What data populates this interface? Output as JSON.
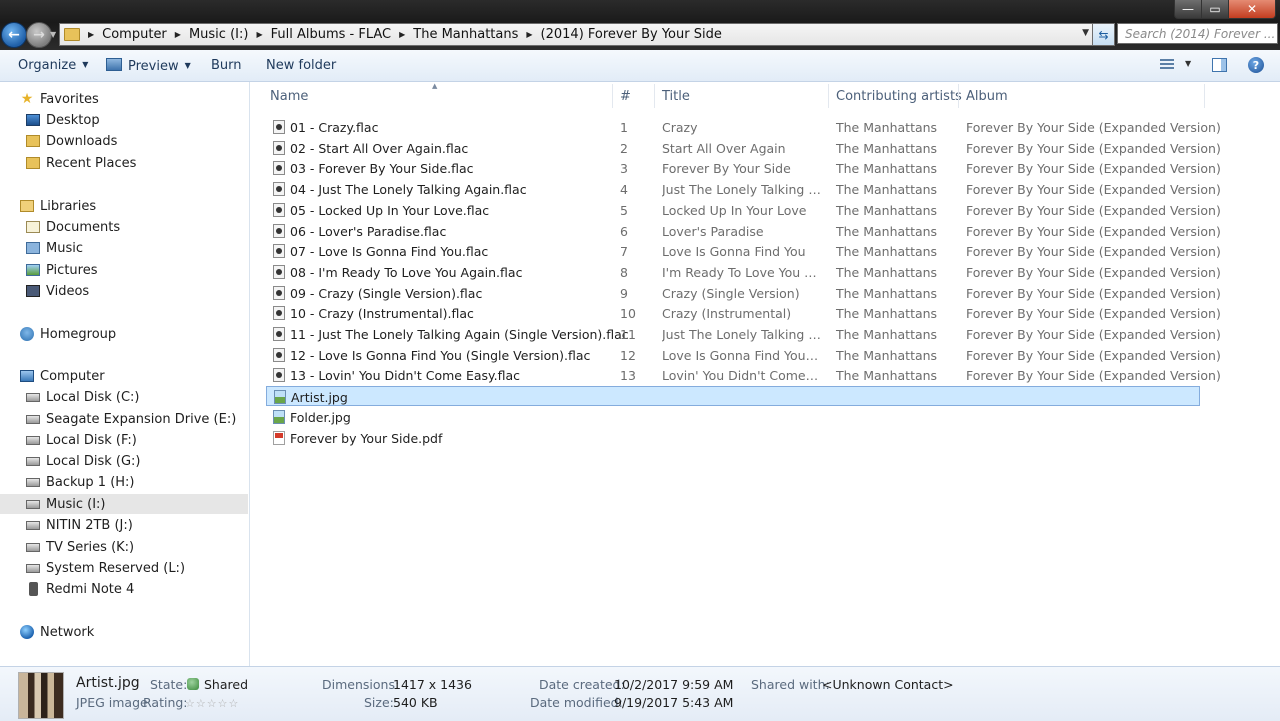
{
  "address": {
    "crumbs": [
      "Computer",
      "Music (I:)",
      "Full Albums - FLAC",
      "The Manhattans",
      "(2014) Forever By Your Side"
    ],
    "search_placeholder": "Search (2014) Forever ..."
  },
  "window_controls": {
    "minimize": "—",
    "maximize": "▭",
    "close": "✕"
  },
  "toolbar": {
    "organize": "Organize",
    "preview": "Preview",
    "burn": "Burn",
    "new_folder": "New folder"
  },
  "nav": {
    "favorites": "Favorites",
    "desktop": "Desktop",
    "downloads": "Downloads",
    "recent": "Recent Places",
    "libraries": "Libraries",
    "documents": "Documents",
    "music": "Music",
    "pictures": "Pictures",
    "videos": "Videos",
    "homegroup": "Homegroup",
    "computer": "Computer",
    "disk_c": "Local Disk (C:)",
    "disk_e": "Seagate Expansion Drive (E:)",
    "disk_f": "Local Disk (F:)",
    "disk_g": "Local Disk (G:)",
    "disk_h": "Backup 1 (H:)",
    "disk_i": "Music (I:)",
    "disk_j": "NITIN 2TB (J:)",
    "disk_k": "TV Series (K:)",
    "disk_l": "System Reserved (L:)",
    "phone": "Redmi Note 4",
    "network": "Network"
  },
  "columns": {
    "name": "Name",
    "num": "#",
    "title": "Title",
    "artists": "Contributing artists",
    "album": "Album"
  },
  "files": [
    {
      "name": "01 - Crazy.flac",
      "num": "1",
      "title": "Crazy",
      "artist": "The Manhattans",
      "album": "Forever By Your Side (Expanded Version)"
    },
    {
      "name": "02 - Start All Over Again.flac",
      "num": "2",
      "title": "Start All Over Again",
      "artist": "The Manhattans",
      "album": "Forever By Your Side (Expanded Version)"
    },
    {
      "name": "03 - Forever By Your Side.flac",
      "num": "3",
      "title": "Forever By Your Side",
      "artist": "The Manhattans",
      "album": "Forever By Your Side (Expanded Version)"
    },
    {
      "name": "04 - Just The Lonely Talking Again.flac",
      "num": "4",
      "title": "Just The Lonely Talking Again",
      "artist": "The Manhattans",
      "album": "Forever By Your Side (Expanded Version)"
    },
    {
      "name": "05 - Locked Up In Your Love.flac",
      "num": "5",
      "title": "Locked Up In Your Love",
      "artist": "The Manhattans",
      "album": "Forever By Your Side (Expanded Version)"
    },
    {
      "name": "06 - Lover's Paradise.flac",
      "num": "6",
      "title": "Lover's Paradise",
      "artist": "The Manhattans",
      "album": "Forever By Your Side (Expanded Version)"
    },
    {
      "name": "07 - Love Is Gonna Find You.flac",
      "num": "7",
      "title": "Love Is Gonna Find You",
      "artist": "The Manhattans",
      "album": "Forever By Your Side (Expanded Version)"
    },
    {
      "name": "08 - I'm Ready To Love You Again.flac",
      "num": "8",
      "title": "I'm Ready To Love You Again",
      "artist": "The Manhattans",
      "album": "Forever By Your Side (Expanded Version)"
    },
    {
      "name": "09 - Crazy (Single Version).flac",
      "num": "9",
      "title": "Crazy (Single Version)",
      "artist": "The Manhattans",
      "album": "Forever By Your Side (Expanded Version)"
    },
    {
      "name": "10 - Crazy (Instrumental).flac",
      "num": "10",
      "title": "Crazy (Instrumental)",
      "artist": "The Manhattans",
      "album": "Forever By Your Side (Expanded Version)"
    },
    {
      "name": "11 - Just The Lonely Talking Again (Single Version).flac",
      "num": "11",
      "title": "Just The Lonely Talking Agai...",
      "artist": "The Manhattans",
      "album": "Forever By Your Side (Expanded Version)"
    },
    {
      "name": "12 - Love Is Gonna Find You (Single Version).flac",
      "num": "12",
      "title": "Love Is Gonna Find You (Sin...",
      "artist": "The Manhattans",
      "album": "Forever By Your Side (Expanded Version)"
    },
    {
      "name": "13 - Lovin' You Didn't Come Easy.flac",
      "num": "13",
      "title": "Lovin' You Didn't Come Easy",
      "artist": "The Manhattans",
      "album": "Forever By Your Side (Expanded Version)"
    }
  ],
  "other_files": [
    {
      "name": "Artist.jpg",
      "type": "jpg"
    },
    {
      "name": "Folder.jpg",
      "type": "jpg"
    },
    {
      "name": "Forever by Your Side.pdf",
      "type": "pdf"
    }
  ],
  "details": {
    "filename": "Artist.jpg",
    "filetype": "JPEG image",
    "state_label": "State:",
    "state_value": "Shared",
    "rating_label": "Rating:",
    "rating_stars": "☆☆☆☆☆",
    "dimensions_label": "Dimensions:",
    "dimensions_value": "1417 x 1436",
    "size_label": "Size:",
    "size_value": "540 KB",
    "created_label": "Date created:",
    "created_value": "10/2/2017 9:59 AM",
    "modified_label": "Date modified:",
    "modified_value": "9/19/2017 5:43 AM",
    "shared_label": "Shared with:",
    "shared_value": "<Unknown Contact>"
  }
}
